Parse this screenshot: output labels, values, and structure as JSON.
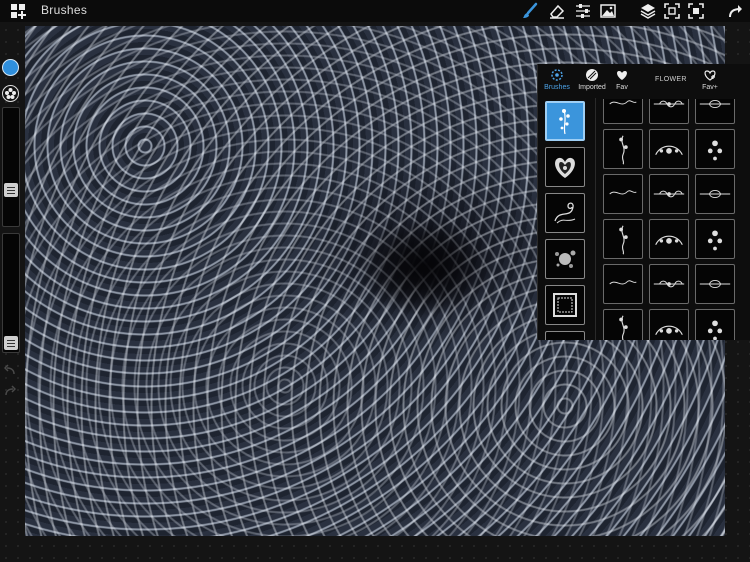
{
  "app": {
    "title": "Brushes"
  },
  "colors": {
    "accent": "#3b95dc",
    "active_color": "#2f8fdc"
  },
  "toolbar": {
    "left_icon": "layers-add-icon",
    "right_icons": [
      "brush-icon",
      "eraser-icon",
      "sliders-icon",
      "image-icon",
      "layers-icon",
      "fit-screen-icon",
      "fullscreen-icon",
      "redo-icon"
    ]
  },
  "brush_panel": {
    "tabs": [
      {
        "label": "Brushes",
        "icon": "sparkle-brush-icon",
        "active": true
      },
      {
        "label": "Imported",
        "icon": "imported-brush-icon",
        "active": false
      },
      {
        "label": "Fav",
        "icon": "heart-icon",
        "active": false
      },
      {
        "label": "Fav+",
        "icon": "heart-plus-icon",
        "active": false
      }
    ],
    "category_label": "FLOWER",
    "categories": [
      "floral-spray",
      "heart",
      "scroll",
      "splash",
      "frame",
      "ornament"
    ],
    "selected_category": 0,
    "grid_rows": 6,
    "grid_cols": 3
  }
}
